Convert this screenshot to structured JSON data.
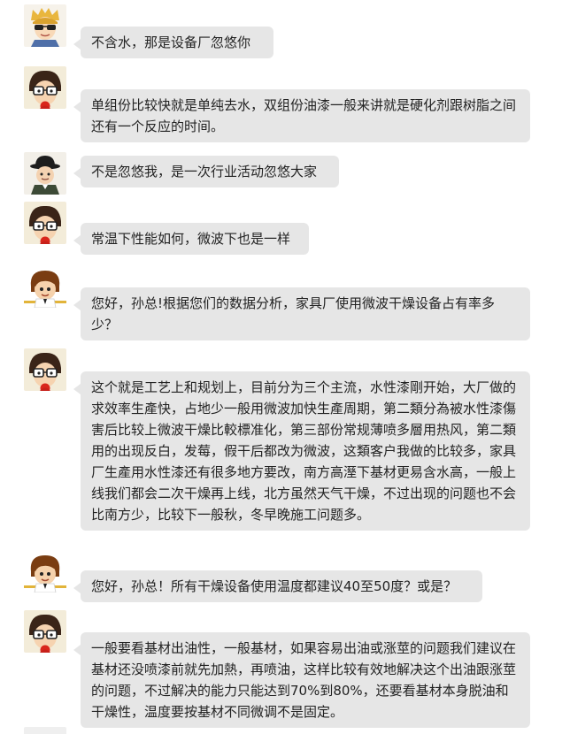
{
  "colors": {
    "bubble": "#e6e6e6",
    "text": "#222222",
    "background": "#ffffff"
  },
  "messages": [
    {
      "avatar": "sunglasses-avatar",
      "text": "不含水，那是设备厂忽悠你"
    },
    {
      "avatar": "glasses-avatar",
      "text": "单组份比较快就是单纯去水，双组份油漆一般来讲就是硬化剂跟树脂之间还有一个反应的时间。"
    },
    {
      "avatar": "bowler-hat-avatar",
      "text": "不是忽悠我，是一次行业活动忽悠大家"
    },
    {
      "avatar": "glasses-avatar",
      "text": "常温下性能如何，微波下也是一样"
    },
    {
      "avatar": "brown-hair-avatar",
      "text": "您好，孙总!根据您们的数据分析，家具厂使用微波干燥设备占有率多少？"
    },
    {
      "avatar": "glasses-avatar",
      "text": "这个就是工艺上和规划上，目前分为三个主流，水性漆剛开始，大厂做的求效率生產快，占地少一般用微波加快生產周期，第二類分為被水性漆傷害后比较上微波干燥比較標准化，第三部份常规薄喷多層用热风，第二類用的出现反白，发莓，假干后都改为微波，这類客户我做的比较多，家具厂生產用水性漆还有很多地方要改，南方高溼下基材更易含水高，一般上线我们都会二次干燥再上线，北方虽然天气干燥，不过出现的问题也不会比南方少，比较下一般秋，冬早晚施工问题多。"
    },
    {
      "avatar": "brown-hair-avatar",
      "text": "您好，孙总！所有干燥设备使用温度都建议40至50度？或是？"
    },
    {
      "avatar": "glasses-avatar",
      "text": "一般要看基材出油性，一般基材，如果容易出油或涨莖的问题我们建议在基材还没喷漆前就先加熱，再喷油，这样比较有效地解决这个出油跟涨莖的问题，不过解决的能力只能达到70%到80%，还要看基材本身脱油和干燥性，温度要按基材不同微调不是固定。"
    }
  ]
}
